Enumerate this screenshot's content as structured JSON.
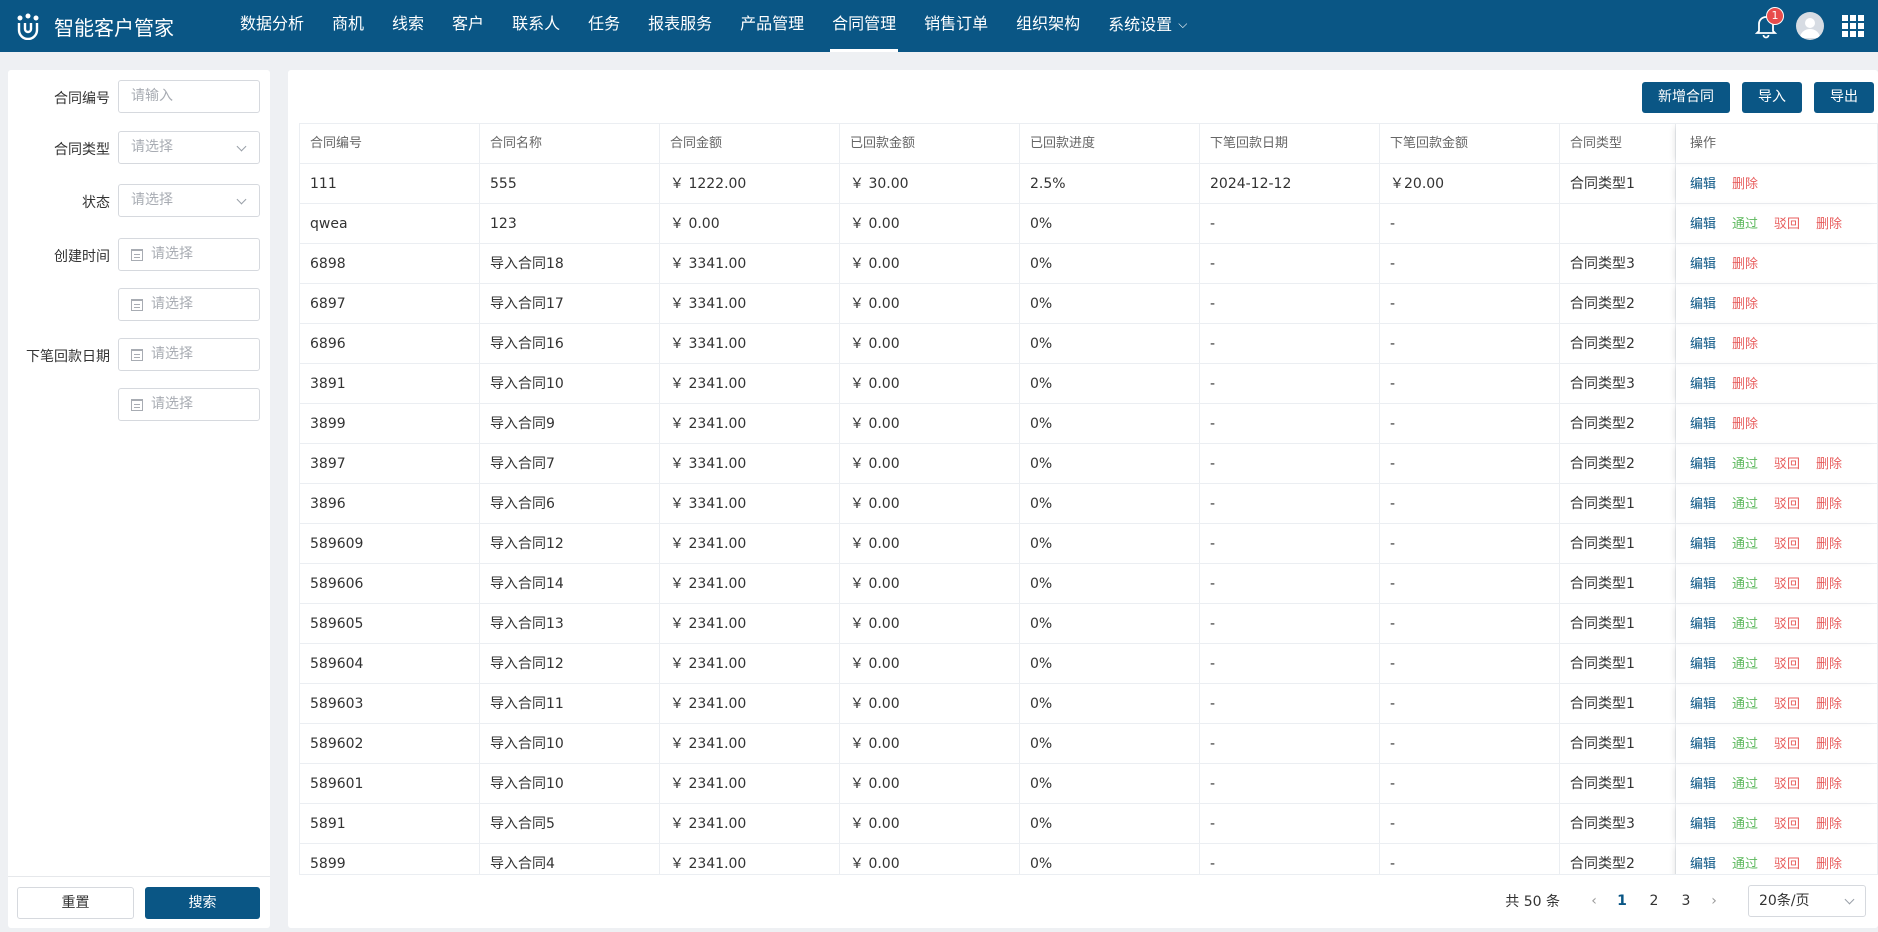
{
  "app": {
    "title": "智能客户管家",
    "brand_color": "#0a5685"
  },
  "nav": {
    "items": [
      "数据分析",
      "商机",
      "线索",
      "客户",
      "联系人",
      "任务",
      "报表服务",
      "产品管理",
      "合同管理",
      "销售订单",
      "组织架构",
      "系统设置"
    ],
    "active_index": 8
  },
  "header": {
    "notification_count": "1"
  },
  "filters": {
    "contract_no": {
      "label": "合同编号",
      "placeholder": "请输入"
    },
    "contract_type": {
      "label": "合同类型",
      "placeholder": "请选择"
    },
    "status": {
      "label": "状态",
      "placeholder": "请选择"
    },
    "created_time": {
      "label": "创建时间",
      "start_placeholder": "请选择",
      "end_placeholder": "请选择"
    },
    "next_payment_date": {
      "label": "下笔回款日期",
      "start_placeholder": "请选择",
      "end_placeholder": "请选择"
    },
    "reset_label": "重置",
    "search_label": "搜索"
  },
  "toolbar": {
    "add_label": "新增合同",
    "import_label": "导入",
    "export_label": "导出"
  },
  "table": {
    "columns": [
      "合同编号",
      "合同名称",
      "合同金额",
      "已回款金额",
      "已回款进度",
      "下笔回款日期",
      "下笔回款金额",
      "合同类型",
      "操作"
    ],
    "op_labels": {
      "edit": "编辑",
      "pass": "通过",
      "reject": "驳回",
      "delete": "删除"
    },
    "rows": [
      {
        "no": "111",
        "name": "555",
        "amount": "￥ 1222.00",
        "paid": "￥ 30.00",
        "progress": "2.5%",
        "next_date": "2024-12-12",
        "next_amount": "￥20.00",
        "type": "合同类型1",
        "ops": [
          "edit",
          "delete"
        ]
      },
      {
        "no": "qwea",
        "name": "123",
        "amount": "￥ 0.00",
        "paid": "￥ 0.00",
        "progress": "0%",
        "next_date": "-",
        "next_amount": "-",
        "type": "",
        "ops": [
          "edit",
          "pass",
          "reject",
          "delete"
        ]
      },
      {
        "no": "6898",
        "name": "导入合同18",
        "amount": "￥ 3341.00",
        "paid": "￥ 0.00",
        "progress": "0%",
        "next_date": "-",
        "next_amount": "-",
        "type": "合同类型3",
        "ops": [
          "edit",
          "delete"
        ]
      },
      {
        "no": "6897",
        "name": "导入合同17",
        "amount": "￥ 3341.00",
        "paid": "￥ 0.00",
        "progress": "0%",
        "next_date": "-",
        "next_amount": "-",
        "type": "合同类型2",
        "ops": [
          "edit",
          "delete"
        ]
      },
      {
        "no": "6896",
        "name": "导入合同16",
        "amount": "￥ 3341.00",
        "paid": "￥ 0.00",
        "progress": "0%",
        "next_date": "-",
        "next_amount": "-",
        "type": "合同类型2",
        "ops": [
          "edit",
          "delete"
        ]
      },
      {
        "no": "3891",
        "name": "导入合同10",
        "amount": "￥ 2341.00",
        "paid": "￥ 0.00",
        "progress": "0%",
        "next_date": "-",
        "next_amount": "-",
        "type": "合同类型3",
        "ops": [
          "edit",
          "delete"
        ]
      },
      {
        "no": "3899",
        "name": "导入合同9",
        "amount": "￥ 2341.00",
        "paid": "￥ 0.00",
        "progress": "0%",
        "next_date": "-",
        "next_amount": "-",
        "type": "合同类型2",
        "ops": [
          "edit",
          "delete"
        ]
      },
      {
        "no": "3897",
        "name": "导入合同7",
        "amount": "￥ 3341.00",
        "paid": "￥ 0.00",
        "progress": "0%",
        "next_date": "-",
        "next_amount": "-",
        "type": "合同类型2",
        "ops": [
          "edit",
          "pass",
          "reject",
          "delete"
        ]
      },
      {
        "no": "3896",
        "name": "导入合同6",
        "amount": "￥ 3341.00",
        "paid": "￥ 0.00",
        "progress": "0%",
        "next_date": "-",
        "next_amount": "-",
        "type": "合同类型1",
        "ops": [
          "edit",
          "pass",
          "reject",
          "delete"
        ]
      },
      {
        "no": "589609",
        "name": "导入合同12",
        "amount": "￥ 2341.00",
        "paid": "￥ 0.00",
        "progress": "0%",
        "next_date": "-",
        "next_amount": "-",
        "type": "合同类型1",
        "ops": [
          "edit",
          "pass",
          "reject",
          "delete"
        ]
      },
      {
        "no": "589606",
        "name": "导入合同14",
        "amount": "￥ 2341.00",
        "paid": "￥ 0.00",
        "progress": "0%",
        "next_date": "-",
        "next_amount": "-",
        "type": "合同类型1",
        "ops": [
          "edit",
          "pass",
          "reject",
          "delete"
        ]
      },
      {
        "no": "589605",
        "name": "导入合同13",
        "amount": "￥ 2341.00",
        "paid": "￥ 0.00",
        "progress": "0%",
        "next_date": "-",
        "next_amount": "-",
        "type": "合同类型1",
        "ops": [
          "edit",
          "pass",
          "reject",
          "delete"
        ]
      },
      {
        "no": "589604",
        "name": "导入合同12",
        "amount": "￥ 2341.00",
        "paid": "￥ 0.00",
        "progress": "0%",
        "next_date": "-",
        "next_amount": "-",
        "type": "合同类型1",
        "ops": [
          "edit",
          "pass",
          "reject",
          "delete"
        ]
      },
      {
        "no": "589603",
        "name": "导入合同11",
        "amount": "￥ 2341.00",
        "paid": "￥ 0.00",
        "progress": "0%",
        "next_date": "-",
        "next_amount": "-",
        "type": "合同类型1",
        "ops": [
          "edit",
          "pass",
          "reject",
          "delete"
        ]
      },
      {
        "no": "589602",
        "name": "导入合同10",
        "amount": "￥ 2341.00",
        "paid": "￥ 0.00",
        "progress": "0%",
        "next_date": "-",
        "next_amount": "-",
        "type": "合同类型1",
        "ops": [
          "edit",
          "pass",
          "reject",
          "delete"
        ]
      },
      {
        "no": "589601",
        "name": "导入合同10",
        "amount": "￥ 2341.00",
        "paid": "￥ 0.00",
        "progress": "0%",
        "next_date": "-",
        "next_amount": "-",
        "type": "合同类型1",
        "ops": [
          "edit",
          "pass",
          "reject",
          "delete"
        ]
      },
      {
        "no": "5891",
        "name": "导入合同5",
        "amount": "￥ 2341.00",
        "paid": "￥ 0.00",
        "progress": "0%",
        "next_date": "-",
        "next_amount": "-",
        "type": "合同类型3",
        "ops": [
          "edit",
          "pass",
          "reject",
          "delete"
        ]
      },
      {
        "no": "5899",
        "name": "导入合同4",
        "amount": "￥ 2341.00",
        "paid": "￥ 0.00",
        "progress": "0%",
        "next_date": "-",
        "next_amount": "-",
        "type": "合同类型2",
        "ops": [
          "edit",
          "pass",
          "reject",
          "delete"
        ]
      }
    ]
  },
  "pagination": {
    "total_label": "共 50 条",
    "pages": [
      "1",
      "2",
      "3"
    ],
    "current_page": "1",
    "page_size_label": "20条/页"
  }
}
